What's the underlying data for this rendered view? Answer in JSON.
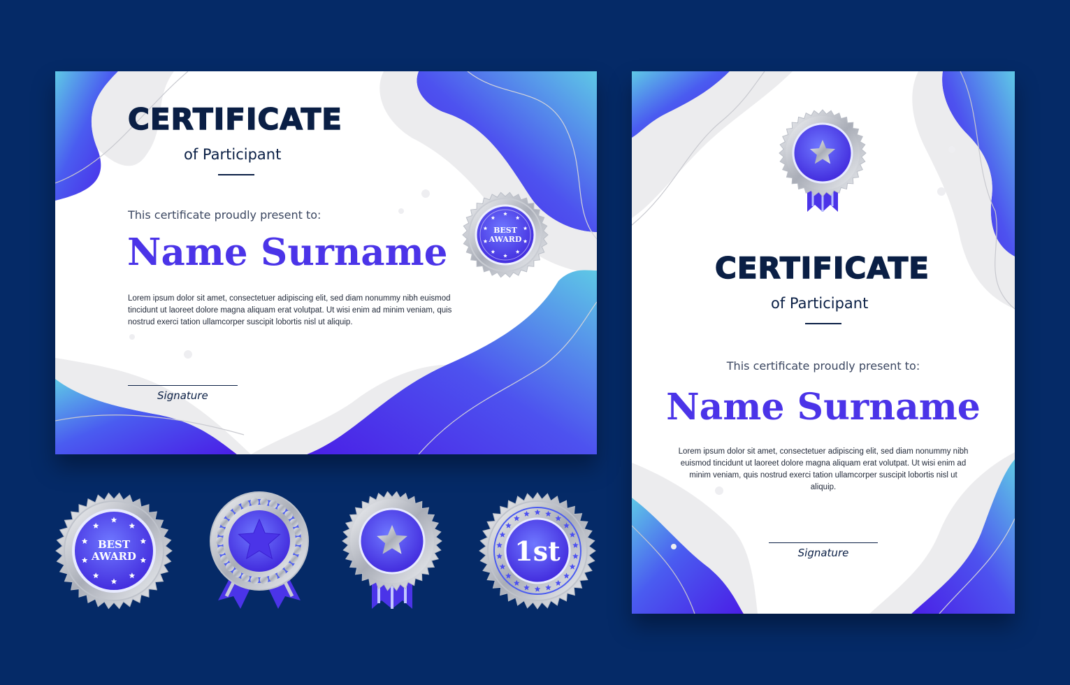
{
  "colors": {
    "background": "#052a67",
    "accent_purple": "#4b34e8",
    "accent_cyan": "#5ec8e6",
    "navy_text": "#0a1f45",
    "silver": "#d3d6dd"
  },
  "landscape_certificate": {
    "title": "CERTIFICATE",
    "subtitle": "of Participant",
    "present_text": "This certificate proudly present to:",
    "name": "Name Surname",
    "body": "Lorem ipsum dolor sit amet, consectetuer adipiscing elit, sed diam nonummy nibh euismod tincidunt ut laoreet dolore magna aliquam erat volutpat. Ut wisi enim ad minim veniam, quis nostrud exerci tation ullamcorper suscipit lobortis nisl ut aliquip.",
    "signature_label": "Signature",
    "badge_text": [
      "BEST",
      "AWARD"
    ]
  },
  "portrait_certificate": {
    "title": "CERTIFICATE",
    "subtitle": "of Participant",
    "present_text": "This certificate proudly present to:",
    "name": "Name Surname",
    "body": "Lorem ipsum dolor sit amet, consectetuer adipiscing elit, sed diam nonummy nibh euismod tincidunt ut laoreet dolore magna aliquam erat volutpat. Ut wisi enim ad minim veniam, quis nostrud exerci tation ullamcorper suscipit lobortis nisl ut aliquip.",
    "signature_label": "Signature",
    "badge_icon": "star-icon"
  },
  "badges": [
    {
      "type": "seal",
      "icon": "stars-ring-icon",
      "text": [
        "BEST",
        "AWARD"
      ]
    },
    {
      "type": "ribbon-seal",
      "icon": "star-icon"
    },
    {
      "type": "ribbon-seal",
      "icon": "star-icon"
    },
    {
      "type": "seal",
      "icon": "stars-ring-icon",
      "text": [
        "1st"
      ]
    }
  ]
}
